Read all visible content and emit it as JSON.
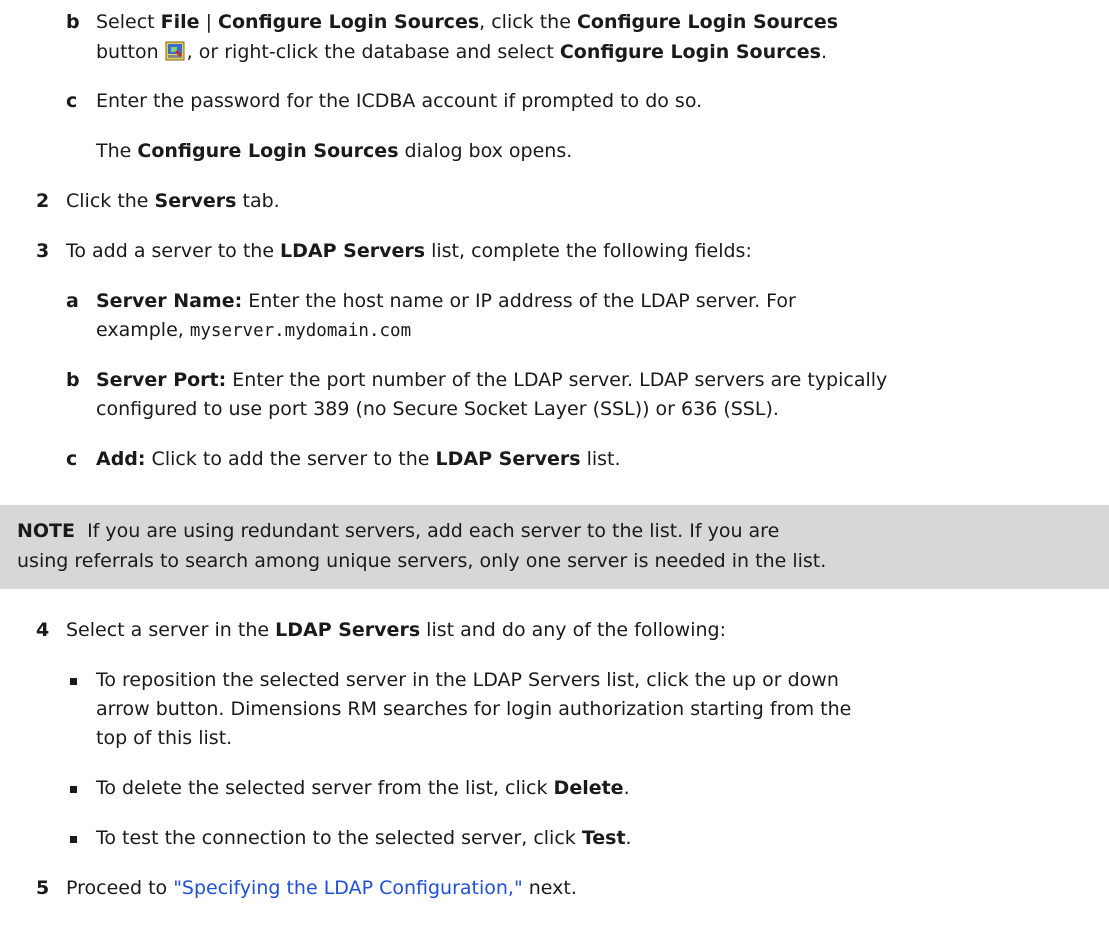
{
  "step1b": {
    "marker": "b",
    "line1": {
      "t1": "Select ",
      "b1": "File",
      "t2": " | ",
      "b2": "Configure Login Sources",
      "t3": ", click the ",
      "b3": "Configure Login Sources"
    },
    "line2": {
      "t1": "button",
      "t2": ", or right-click the database and select ",
      "b1": "Configure Login Sources",
      "t3": "."
    },
    "icon": "configure-login-sources-icon"
  },
  "step1c": {
    "marker": "c",
    "text": "Enter the password for the ICDBA account if prompted to do so.",
    "result": {
      "t1": "The ",
      "b1": "Configure Login Sources",
      "t2": " dialog box opens."
    }
  },
  "step2": {
    "number": "2",
    "t1": "Click the ",
    "b1": "Servers",
    "t2": " tab."
  },
  "step3": {
    "number": "3",
    "t1": "To add a server to the ",
    "b1": "LDAP Servers",
    "t2": " list, complete the following fields:",
    "a": {
      "marker": "a",
      "label": "Server Name:",
      "line1": " Enter the host name or IP address of the LDAP server. For",
      "line2_t1": "example, ",
      "code": "myserver.mydomain.com"
    },
    "b": {
      "marker": "b",
      "label": "Server Port:",
      "line1": " Enter the port number of the LDAP server. LDAP servers are typically",
      "line2": "configured to use port 389 (no Secure Socket Layer (SSL)) or 636 (SSL)."
    },
    "c": {
      "marker": "c",
      "label": "Add:",
      "t1": " Click to add the server to the ",
      "b1": "LDAP Servers",
      "t2": " list."
    }
  },
  "note": {
    "label": "NOTE",
    "line1": "  If you are using redundant servers, add each server to the list. If you are",
    "line2": "using referrals to search among unique servers, only one server is needed in the list."
  },
  "step4": {
    "number": "4",
    "t1": "Select a server in the ",
    "b1": "LDAP Servers",
    "t2": " list and do any of the following:",
    "bullets": {
      "reposition": {
        "line1": "To reposition the selected server in the LDAP Servers list, click the up or down",
        "line2": "arrow button. Dimensions RM searches for login authorization starting from the",
        "line3": "top of this list."
      },
      "delete": {
        "t1": "To delete the selected server from the list, click ",
        "b1": "Delete",
        "t2": "."
      },
      "test": {
        "t1": "To test the connection to the selected server, click ",
        "b1": "Test",
        "t2": "."
      }
    }
  },
  "step5": {
    "number": "5",
    "t1": "Proceed to ",
    "link": "\"Specifying the LDAP Configuration,\"",
    "t2": " next."
  },
  "colors": {
    "text": "#1a1a1a",
    "link": "#1e4fd6",
    "note_bg": "#d7d7d7"
  }
}
